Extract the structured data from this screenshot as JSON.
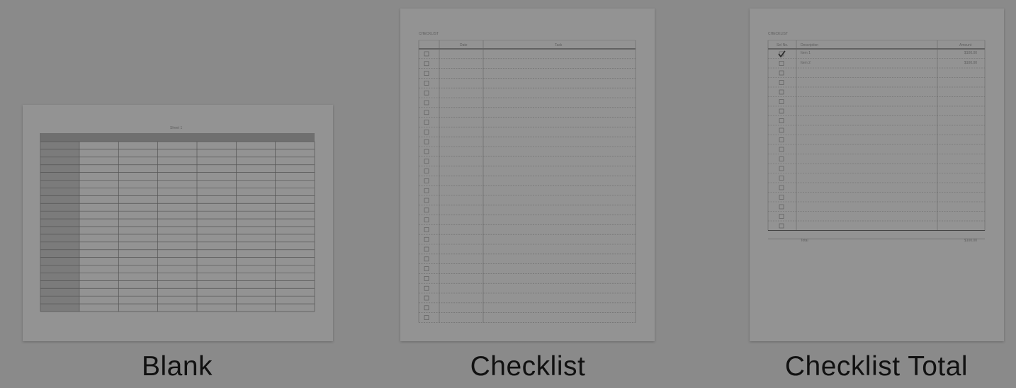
{
  "templates": [
    {
      "name": "Blank",
      "thumbnail": {
        "sheet_title": "Sheet 1",
        "columns": 7,
        "rows": 22
      }
    },
    {
      "name": "Checklist",
      "thumbnail": {
        "sheet_title": "CHECKLIST",
        "headers": [
          "",
          "Date",
          "Task"
        ],
        "rows": 28
      }
    },
    {
      "name": "Checklist Total",
      "thumbnail": {
        "sheet_title": "CHECKLIST",
        "headers": [
          "Sel No.",
          "Description",
          "Amount"
        ],
        "rows": 19,
        "sample_rows": [
          {
            "description": "Item 1",
            "amount": "$100.00",
            "checked": true
          },
          {
            "description": "Item 2",
            "amount": "$100.00",
            "checked": false
          }
        ],
        "footer_label": "Total",
        "footer_amount": "$100.00"
      }
    }
  ]
}
